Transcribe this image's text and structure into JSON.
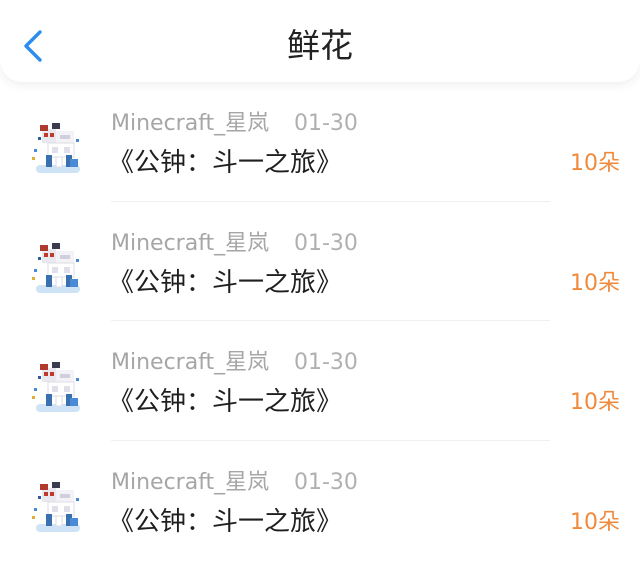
{
  "header": {
    "title": "鲜花",
    "back_icon": "chevron-left-icon",
    "accent_color": "#2d8cf0"
  },
  "records": [
    {
      "user": "Minecraft_星岚",
      "date": "01-30",
      "book": "《公钟：斗一之旅》",
      "amount": "10朵",
      "avatar_icon": "pixel-character-avatar"
    },
    {
      "user": "Minecraft_星岚",
      "date": "01-30",
      "book": "《公钟：斗一之旅》",
      "amount": "10朵",
      "avatar_icon": "pixel-character-avatar"
    },
    {
      "user": "Minecraft_星岚",
      "date": "01-30",
      "book": "《公钟：斗一之旅》",
      "amount": "10朵",
      "avatar_icon": "pixel-character-avatar"
    },
    {
      "user": "Minecraft_星岚",
      "date": "01-30",
      "book": "《公钟：斗一之旅》",
      "amount": "10朵",
      "avatar_icon": "pixel-character-avatar"
    }
  ],
  "colors": {
    "amount": "#f08a3c",
    "secondary_text": "#a6a6a6"
  }
}
